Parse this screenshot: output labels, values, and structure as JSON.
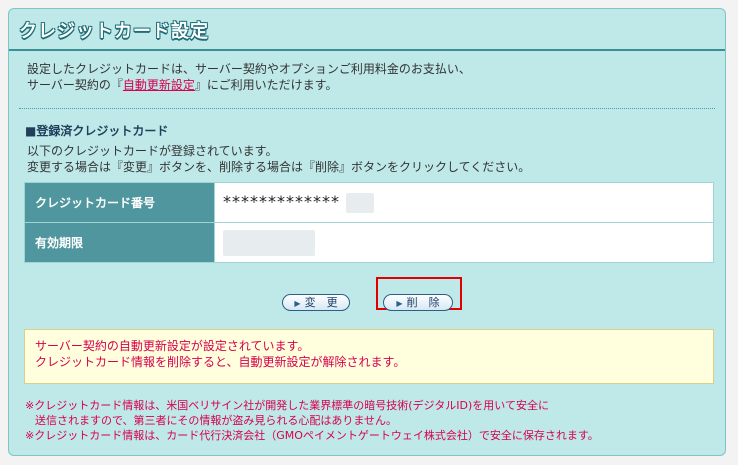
{
  "header": {
    "title": "クレジットカード設定"
  },
  "intro": {
    "line1": "設定したクレジットカードは、サーバー契約やオプションご利用料金のお支払い、",
    "line2_before": "サーバー契約の『",
    "line2_link": "自動更新設定",
    "line2_after": "』にご利用いただけます。"
  },
  "section": {
    "title": "■登録済クレジットカード",
    "desc1": "以下のクレジットカードが登録されています。",
    "desc2": "変更する場合は『変更』ボタンを、削除する場合は『削除』ボタンをクリックしてください。"
  },
  "card_table": {
    "rows": [
      {
        "label": "クレジットカード番号",
        "value": "*************"
      },
      {
        "label": "有効期限",
        "value": ""
      }
    ]
  },
  "buttons": {
    "change": "変　更",
    "delete": "削　除"
  },
  "notice": {
    "line1": "サーバー契約の自動更新設定が設定されています。",
    "line2": "クレジットカード情報を削除すると、自動更新設定が解除されます。"
  },
  "footnotes": {
    "line1": "※クレジットカード情報は、米国ベリサイン社が開発した業界標準の暗号技術(デジタルID)を用いて安全に",
    "line2": "送信されますので、第三者にその情報が盗み見られる心配はありません。",
    "line3": "※クレジットカード情報は、カード代行決済会社（GMOペイメントゲートウェイ株式会社）で安全に保存されます。"
  }
}
